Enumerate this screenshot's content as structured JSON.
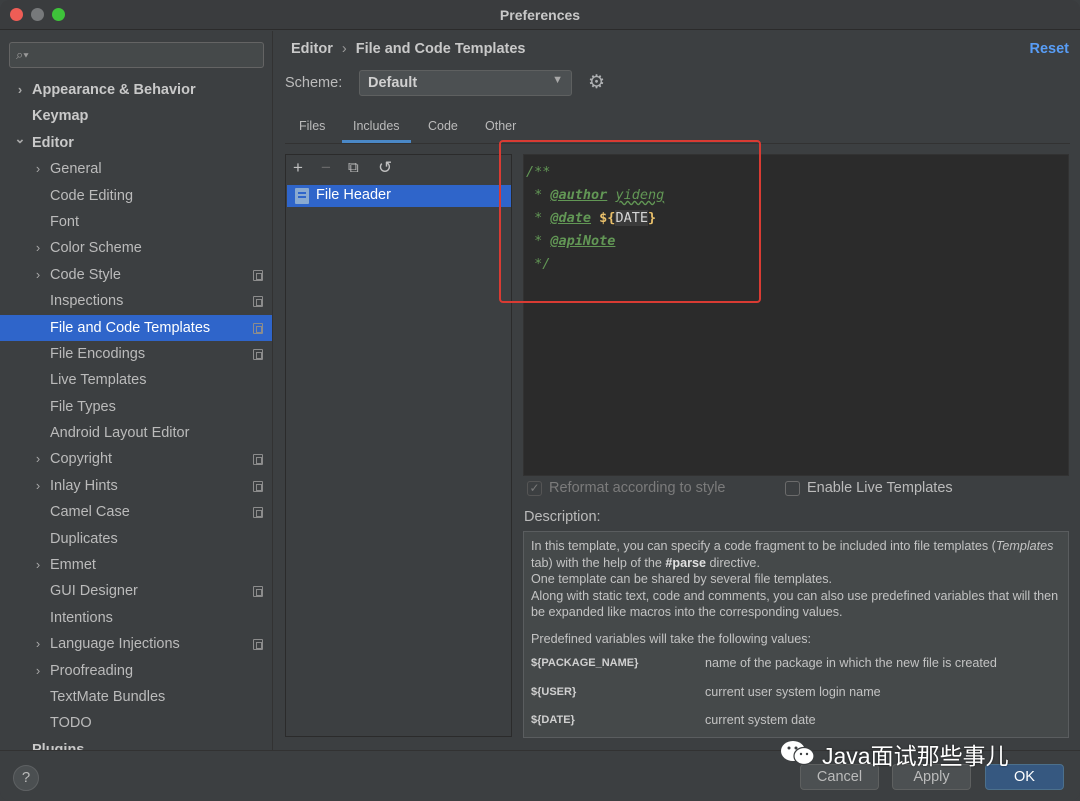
{
  "window": {
    "title": "Preferences"
  },
  "sidebar": {
    "search_placeholder": "",
    "items": [
      {
        "label": "Appearance & Behavior",
        "expandable": true,
        "bold": true
      },
      {
        "label": "Keymap",
        "bold": true
      },
      {
        "label": "Editor",
        "expanded": true,
        "bold": true
      },
      {
        "label": "General",
        "expandable": true
      },
      {
        "label": "Code Editing"
      },
      {
        "label": "Font"
      },
      {
        "label": "Color Scheme",
        "expandable": true
      },
      {
        "label": "Code Style",
        "expandable": true,
        "project_icon": true
      },
      {
        "label": "Inspections",
        "project_icon": true
      },
      {
        "label": "File and Code Templates",
        "selected": true,
        "project_icon": true
      },
      {
        "label": "File Encodings",
        "project_icon": true
      },
      {
        "label": "Live Templates"
      },
      {
        "label": "File Types"
      },
      {
        "label": "Android Layout Editor"
      },
      {
        "label": "Copyright",
        "expandable": true,
        "project_icon": true
      },
      {
        "label": "Inlay Hints",
        "expandable": true,
        "project_icon": true
      },
      {
        "label": "Camel Case",
        "project_icon": true
      },
      {
        "label": "Duplicates"
      },
      {
        "label": "Emmet",
        "expandable": true
      },
      {
        "label": "GUI Designer",
        "project_icon": true
      },
      {
        "label": "Intentions"
      },
      {
        "label": "Language Injections",
        "expandable": true,
        "project_icon": true
      },
      {
        "label": "Proofreading",
        "expandable": true
      },
      {
        "label": "TextMate Bundles"
      },
      {
        "label": "TODO"
      },
      {
        "label": "Plugins",
        "bold": true
      }
    ]
  },
  "breadcrumb": {
    "parent": "Editor",
    "separator": "›",
    "current": "File and Code Templates"
  },
  "reset_label": "Reset",
  "scheme": {
    "label": "Scheme:",
    "value": "Default",
    "arrow": "▼"
  },
  "tabs": [
    {
      "label": "Files"
    },
    {
      "label": "Includes",
      "active": true
    },
    {
      "label": "Code"
    },
    {
      "label": "Other"
    }
  ],
  "toolbar": {
    "add": "+",
    "remove": "−",
    "copy": "⧉",
    "revert": "↺"
  },
  "templates": [
    {
      "label": "File Header",
      "selected": true
    }
  ],
  "editor": {
    "lines": {
      "l1": "/**",
      "l2_prefix": " * ",
      "l2_tag": "@author",
      "l2_value": "yideng",
      "l3_prefix": " * ",
      "l3_tag": "@date",
      "l3_dollar": "${",
      "l3_var": "DATE",
      "l3_close": "}",
      "l4_prefix": " * ",
      "l4_tag": "@apiNote",
      "l5": " */"
    }
  },
  "options": {
    "reformat_label": "Reformat according to style",
    "reformat_checked": true,
    "reformat_check_mark": "✓",
    "live_templates_label": "Enable Live Templates",
    "live_templates_checked": false
  },
  "description": {
    "label": "Description:",
    "p1_a": "In this template, you can specify a code fragment to be included into file templates (",
    "p1_italic": "Templates",
    "p1_b": " tab) with the help of the ",
    "p1_bold": "#parse",
    "p1_c": " directive.",
    "p2": "One template can be shared by several file templates.",
    "p3": "Along with static text, code and comments, you can also use predefined variables that will then be expanded like macros into the corresponding values.",
    "p4": "Predefined variables will take the following values:",
    "variables": [
      {
        "name": "${PACKAGE_NAME}",
        "desc": "name of the package in which the new file is created"
      },
      {
        "name": "${USER}",
        "desc": "current user system login name"
      },
      {
        "name": "${DATE}",
        "desc": "current system date"
      }
    ]
  },
  "buttons": {
    "help": "?",
    "cancel": "Cancel",
    "apply": "Apply",
    "ok": "OK"
  },
  "watermark": {
    "text": "Java面试那些事儿"
  },
  "colors": {
    "accent": "#2f65ca",
    "link": "#589df6",
    "highlight_box": "#d93b33",
    "ok_button": "#365880"
  }
}
